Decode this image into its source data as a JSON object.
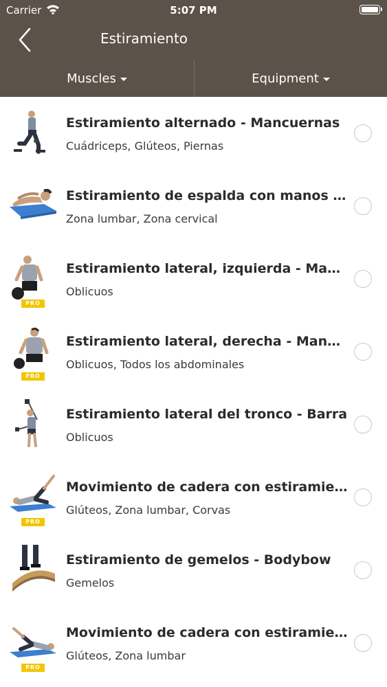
{
  "status": {
    "carrier": "Carrier",
    "time": "5:07 PM"
  },
  "nav": {
    "title": "Estiramiento"
  },
  "filters": {
    "muscles": "Muscles",
    "equipment": "Equipment"
  },
  "pro_badge": "PRO",
  "colors": {
    "header_bg": "#5b5249",
    "pro_badge": "#f2c500"
  },
  "exercises": [
    {
      "name": "Estiramiento alternado - Mancuernas",
      "muscles": "Cuádriceps, Glúteos, Piernas",
      "pro": false,
      "thumb": "lunge-stretch-figure"
    },
    {
      "name": "Estiramiento de espalda con manos sob...",
      "muscles": "Zona lumbar, Zona cervical",
      "pro": false,
      "thumb": "back-stretch-figure"
    },
    {
      "name": "Estiramiento lateral, izquierda - Mancue...",
      "muscles": "Oblicuos",
      "pro": true,
      "thumb": "side-stretch-figure"
    },
    {
      "name": "Estiramiento lateral, derecha - Mancuer...",
      "muscles": "Oblicuos, Todos los abdominales",
      "pro": true,
      "thumb": "side-stretch-figure"
    },
    {
      "name": "Estiramiento lateral del tronco - Barra",
      "muscles": "Oblicuos",
      "pro": false,
      "thumb": "barbell-side-bend-figure"
    },
    {
      "name": "Movimiento de cadera con estiramiento...",
      "muscles": "Glúteos, Zona lumbar, Corvas",
      "pro": true,
      "thumb": "hip-raise-figure"
    },
    {
      "name": "Estiramiento de gemelos - Bodybow",
      "muscles": "Gemelos",
      "pro": false,
      "thumb": "calf-stretch-figure"
    },
    {
      "name": "Movimiento de cadera con estiramiento...",
      "muscles": "Glúteos, Zona lumbar",
      "pro": true,
      "thumb": "hip-raise-figure"
    }
  ]
}
